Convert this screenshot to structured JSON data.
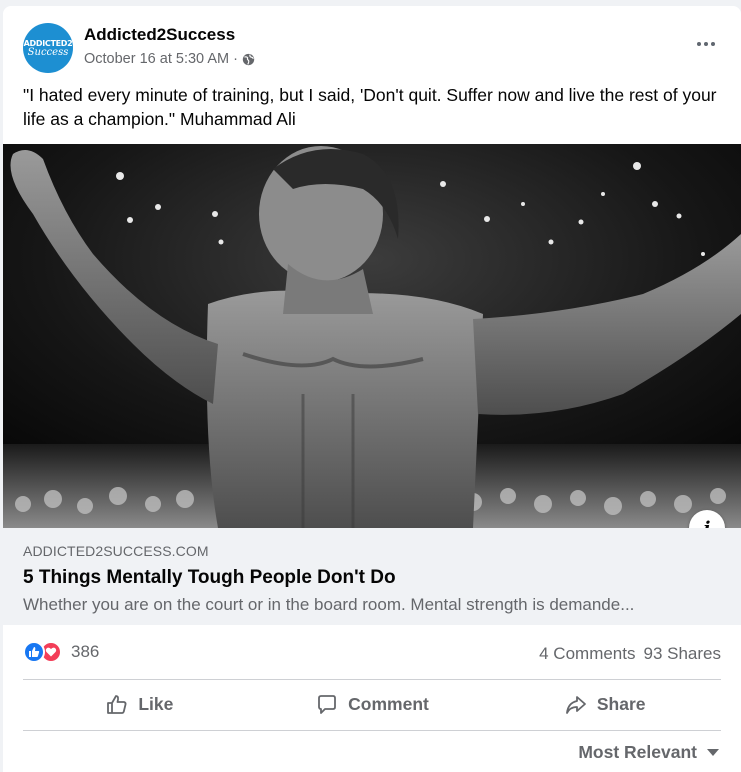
{
  "post": {
    "page_name": "Addicted2Success",
    "avatar_text_line1": "ADDICTED2",
    "avatar_text_line2": "Success",
    "timestamp": "October 16 at 5:30 AM",
    "separator": "·",
    "privacy_icon": "globe-icon",
    "more_icon": "more-options-icon",
    "text": "\"I hated every minute of training, but I said, 'Don't quit. Suffer now and live the rest of your life as a champion.\" Muhammad Ali"
  },
  "image": {
    "info_label": "i"
  },
  "link_preview": {
    "domain": "ADDICTED2SUCCESS.COM",
    "title": "5 Things Mentally Tough People Don't Do",
    "description": "Whether you are on the court or in the board room. Mental strength is demande..."
  },
  "stats": {
    "reaction_count": "386",
    "comments": "4 Comments",
    "shares": "93 Shares",
    "like_color": "#1877f2",
    "love_color": "#f33e58"
  },
  "actions": {
    "like": "Like",
    "comment": "Comment",
    "share": "Share"
  },
  "comments_filter": {
    "label": "Most Relevant"
  }
}
